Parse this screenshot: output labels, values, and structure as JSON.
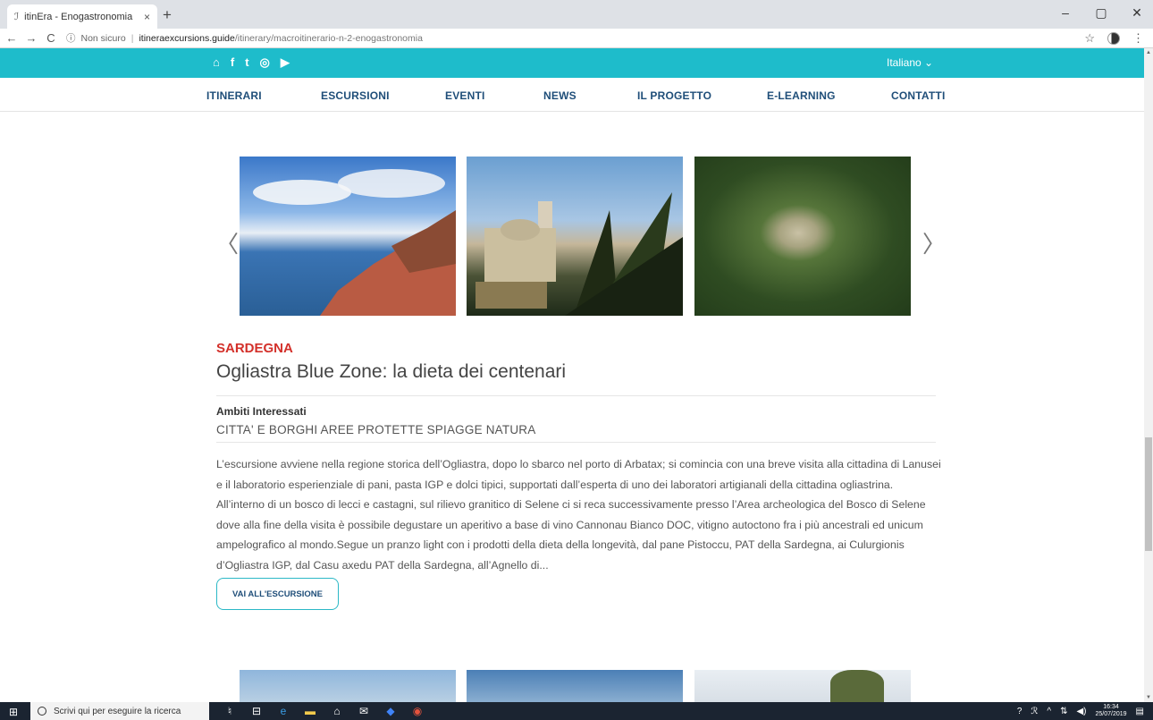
{
  "browser": {
    "tab_title": "itinEra - Enogastronomia",
    "tab_close": "×",
    "new_tab": "+",
    "security_label": "Non sicuro",
    "url_host": "itineraexcursions.guide",
    "url_path": "/itinerary/macroitinerario-n-2-enogastronomia",
    "window_controls": [
      "–",
      "▢",
      "✕"
    ]
  },
  "site_top": {
    "social_icons": [
      "home-icon",
      "facebook-icon",
      "twitter-icon",
      "instagram-icon",
      "youtube-icon"
    ],
    "language": "Italiano ⌄"
  },
  "nav": {
    "items": [
      "ITINERARI",
      "ESCURSIONI",
      "EVENTI",
      "NEWS",
      "IL PROGETTO",
      "E-LEARNING",
      "CONTATTI"
    ]
  },
  "carousel": {
    "prev": "〈",
    "next": "〉"
  },
  "article": {
    "region": "SARDEGNA",
    "title": "Ogliastra Blue Zone: la dieta dei centenari",
    "ambiti_label": "Ambiti Interessati",
    "ambiti_value": "CITTA' E BORGHI AREE PROTETTE SPIAGGE NATURA",
    "description": "L’escursione avviene nella regione storica dell’Ogliastra, dopo lo sbarco nel porto di Arbatax; si comincia con una breve visita alla cittadina di Lanusei e il laboratorio esperienziale di pani, pasta IGP e dolci tipici, supportati dall’esperta di uno dei laboratori artigianali della cittadina ogliastrina. All’interno di un bosco di lecci e castagni, sul rilievo granitico di Selene ci si reca successivamente presso l’Area archeologica del Bosco di Selene dove alla fine della visita è possibile degustare un aperitivo a base di vino Cannonau Bianco DOC, vitigno autoctono fra i più ancestrali ed unicum ampelografico al mondo.Segue un pranzo light con i prodotti della dieta della longevità, dal pane Pistoccu, PAT della Sardegna, ai Culurgionis d’Ogliastra IGP, dal Casu axedu PAT della Sardegna, all’Agnello di...",
    "cta": "VAI ALL'ESCURSIONE"
  },
  "taskbar": {
    "search_placeholder": "Scrivi qui per eseguire la ricerca",
    "time": "16:34",
    "date": "25/07/2019"
  }
}
